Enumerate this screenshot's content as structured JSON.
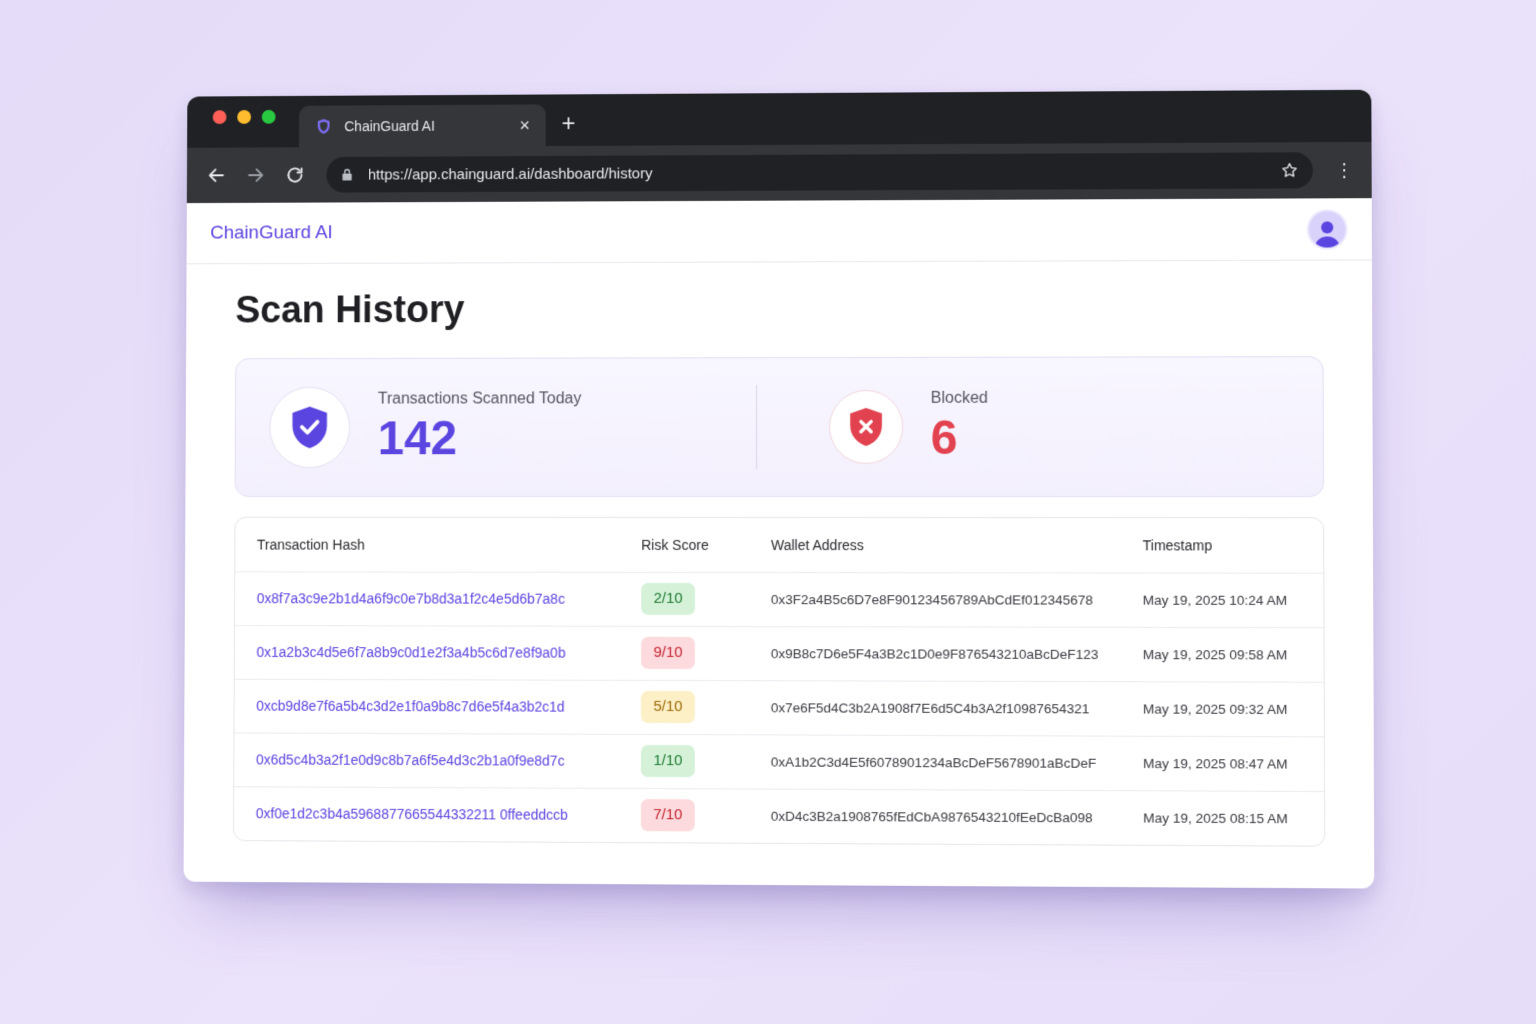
{
  "browser": {
    "tab_title": "ChainGuard AI",
    "url": "https://app.chainguard.ai/dashboard/history",
    "close_glyph": "×",
    "new_tab_glyph": "+",
    "menu_glyph": "⋮"
  },
  "app": {
    "brand": "ChainGuard AI"
  },
  "page": {
    "title": "Scan History"
  },
  "stats": {
    "scanned_label": "Transactions Scanned Today",
    "scanned_value": "142",
    "blocked_label": "Blocked",
    "blocked_value": "6"
  },
  "table": {
    "headers": {
      "hash": "Transaction Hash",
      "risk": "Risk Score",
      "wallet": "Wallet Address",
      "timestamp": "Timestamp"
    },
    "rows": [
      {
        "hash": "0x8f7a3c9e2b1d4a6f9c0e7b8d3a1f2c4e5d6b7a8c",
        "risk": "2/10",
        "risk_level": "low",
        "wallet": "0x3F2a4B5c6D7e8F90123456789AbCdEf012345678",
        "timestamp": "May 19, 2025 10:24 AM"
      },
      {
        "hash": "0x1a2b3c4d5e6f7a8b9c0d1e2f3a4b5c6d7e8f9a0b",
        "risk": "9/10",
        "risk_level": "high",
        "wallet": "0x9B8c7D6e5F4a3B2c1D0e9F876543210aBcDeF123",
        "timestamp": "May 19, 2025 09:58 AM"
      },
      {
        "hash": "0xcb9d8e7f6a5b4c3d2e1f0a9b8c7d6e5f4a3b2c1d",
        "risk": "5/10",
        "risk_level": "mid",
        "wallet": "0x7e6F5d4C3b2A1908f7E6d5C4b3A2f10987654321",
        "timestamp": "May 19, 2025 09:32 AM"
      },
      {
        "hash": "0x6d5c4b3a2f1e0d9c8b7a6f5e4d3c2b1a0f9e8d7c",
        "risk": "1/10",
        "risk_level": "low",
        "wallet": "0xA1b2C3d4E5f6078901234aBcDeF5678901aBcDeF",
        "timestamp": "May 19, 2025 08:47 AM"
      },
      {
        "hash": "0xf0e1d2c3b4a5968877665544332211 0ffeeddccb",
        "risk": "7/10",
        "risk_level": "high",
        "wallet": "0xD4c3B2a1908765fEdCbA9876543210fEeDcBa098",
        "timestamp": "May 19, 2025 08:15 AM"
      }
    ]
  },
  "colors": {
    "accent": "#5b45e0",
    "danger": "#e2424f",
    "risk_low_bg": "#d5f2d9",
    "risk_high_bg": "#fddadd",
    "risk_mid_bg": "#fdf0c6"
  },
  "icons": {
    "tab_favicon": "shield-icon",
    "scanned": "shield-check-icon",
    "blocked": "shield-x-icon",
    "avatar": "user-avatar-icon"
  }
}
